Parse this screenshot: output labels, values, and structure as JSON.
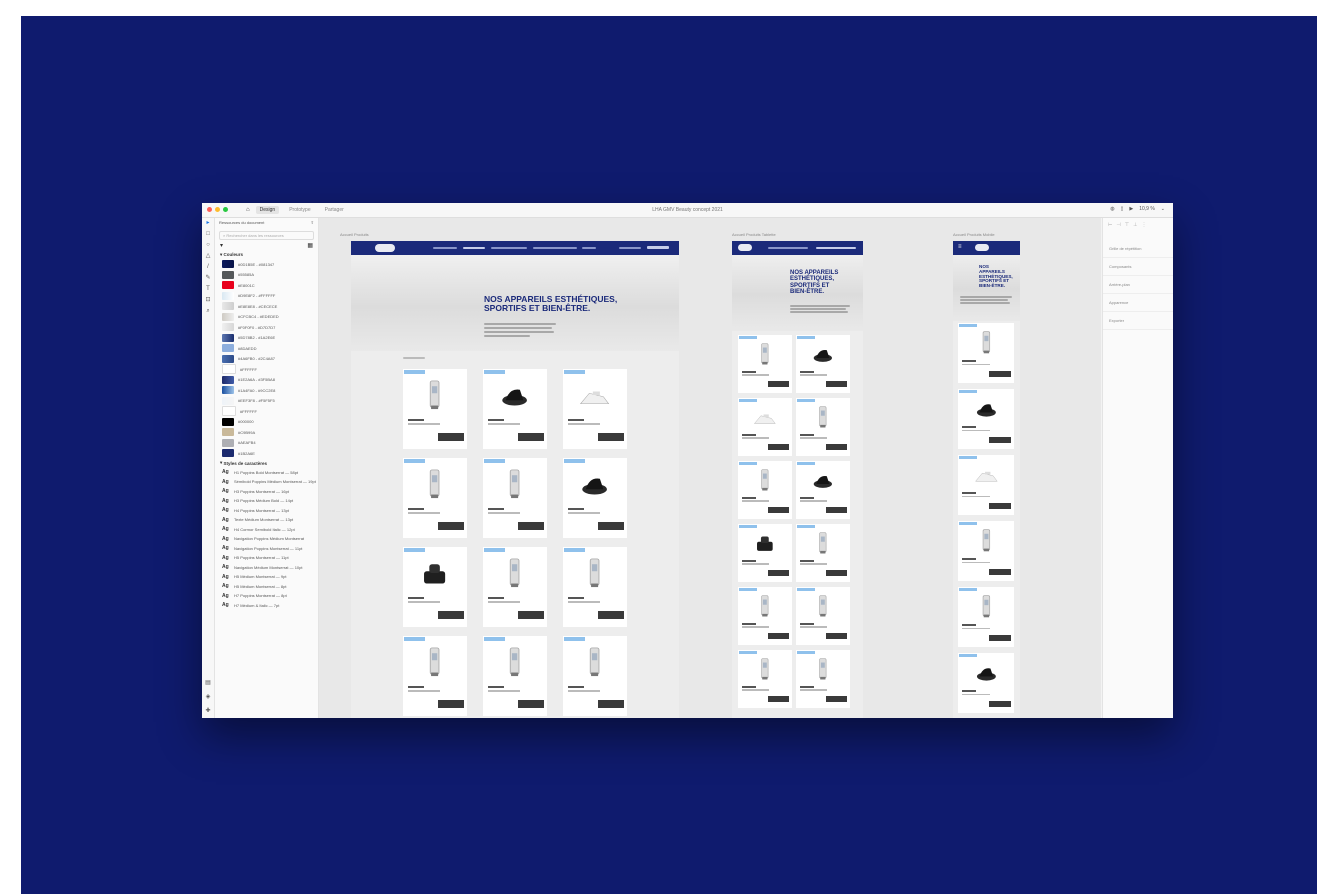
{
  "app": {
    "tabs": [
      "Design",
      "Prototype",
      "Partager"
    ],
    "active_tab": "Design",
    "document_title": "LHA GMV Beauty concept 2021",
    "zoom": "10,9 %"
  },
  "layers_panel": {
    "search_placeholder": "Rechercher dans les ressources",
    "doc_title": "Ressources du document",
    "colors_section": "Couleurs",
    "typo_section": "Styles de caractères",
    "colors": [
      {
        "label": "#0D1B5E - #081347",
        "hex": "#0d1b5e",
        "hex2": "#081347"
      },
      {
        "label": "#55585A",
        "hex": "#55585a"
      },
      {
        "label": "#E8001C",
        "hex": "#e8001c"
      },
      {
        "label": "#D9E8F2 - #FFFFFF",
        "hex": "#d9e8f2",
        "hex2": "#ffffff"
      },
      {
        "label": "#E8E8E8 - #CECECE",
        "hex": "#e8e8e8",
        "hex2": "#cecece"
      },
      {
        "label": "#CFCBC4 - #EDEDED",
        "hex": "#cfcbc4",
        "hex2": "#ededed"
      },
      {
        "label": "#F0F0F0 - #D7D7D7",
        "hex": "#f0f0f0",
        "hex2": "#d7d7d7"
      },
      {
        "label": "#5D78B2 - #1A2E6E",
        "hex": "#5d78b2",
        "hex2": "#1a2e6e"
      },
      {
        "label": "#8DAEDD",
        "hex": "#8daedd"
      },
      {
        "label": "#4A6FB0 - #2C4A87",
        "hex": "#4a6fb0",
        "hex2": "#2c4a87"
      },
      {
        "label": "#FFFFFF",
        "hex": "#ffffff"
      },
      {
        "label": "#1E2A6A - #3F5BA8",
        "hex": "#1e2a6a",
        "hex2": "#3f5ba8"
      },
      {
        "label": "#1A4FA0 - #9CC2E8",
        "hex": "#1a4fa0",
        "hex2": "#9cc2e8"
      },
      {
        "label": "#EEF3F8 - #F5F5F5",
        "hex": "#eef3f8",
        "hex2": "#f5f5f5"
      },
      {
        "label": "#FFFFFF",
        "hex": "#ffffff"
      },
      {
        "label": "#000000",
        "hex": "#000000"
      },
      {
        "label": "#C9B99A",
        "hex": "#c9b99a"
      },
      {
        "label": "#AEAFB4",
        "hex": "#aeafb4"
      },
      {
        "label": "#1B2A6E",
        "hex": "#1b2a6e"
      }
    ],
    "typos": [
      "H1 Poppins Bold Montserrat — 58pt",
      "Sémibold Poppins Médium Montserrat — 19pt",
      "H3 Poppins Montserrat — 16pt",
      "H3 Poppins Médium Bold — 14pt",
      "H4 Poppins Montserrat — 13pt",
      "Texte Médium Montserrat — 13pt",
      "H4 Cormor Semibold Italic — 12pt",
      "Navigation Poppins Médium Montserrat",
      "Navigation Poppins Montserrat — 11pt",
      "H5 Poppins Montserrat — 11pt",
      "Navigation Médium Montserrat — 10pt",
      "H5 Médium Montserrat — 9pt",
      "H5 Médium Montserrat — 8pt",
      "H7 Poppins Montserrat — 8pt",
      "H7 Médium & Italic — 7pt"
    ]
  },
  "artboards": {
    "desktop_label": "Accueil Produits",
    "tablet_label": "Accueil Produits Tablette",
    "mobile_label": "Accueil Produits Mobile",
    "hero_title": "NOS APPAREILS ESTHÉTIQUES, SPORTIFS ET BIEN-ÊTRE.",
    "hero_lines_mobile": [
      "NOS",
      "APPAREILS",
      "ESTHÉTIQUES,",
      "SPORTIFS ET",
      "BIEN-ÊTRE."
    ],
    "hero_lines_tablet": [
      "NOS APPAREILS",
      "ESTHÉTIQUES,",
      "SPORTIFS ET",
      "BIEN-ÊTRE."
    ]
  },
  "properties_panel": {
    "items": [
      "Grille de répétition",
      "Composants",
      "Arrière-plan",
      "Apparence",
      "Exporter"
    ]
  },
  "colors": {
    "background": "#0f1b6e",
    "header_navy": "#1b2a7a",
    "badge_blue": "#8fc1ec",
    "button_dark": "#3a3a3a"
  }
}
